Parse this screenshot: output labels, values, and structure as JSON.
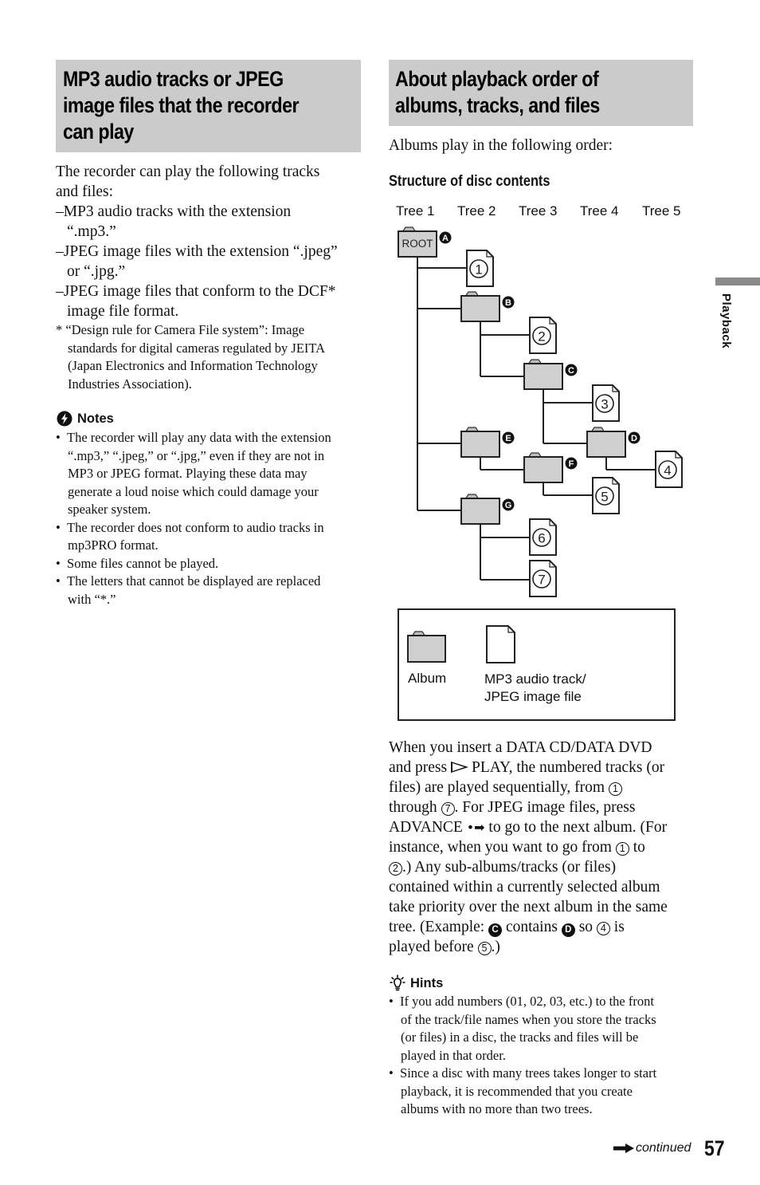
{
  "left_section": {
    "title_lines": [
      "MP3 audio tracks or JPEG",
      "image files that the recorder",
      "can play"
    ],
    "intro_lines": [
      "The recorder can play the following tracks",
      "and files:"
    ],
    "file_types": [
      {
        "dash": "–",
        "lines": [
          "MP3 audio tracks with the extension",
          "“.mp3.”"
        ]
      },
      {
        "dash": "–",
        "lines": [
          "JPEG image files with the extension “.jpeg”",
          "or “.jpg.”"
        ]
      },
      {
        "dash": "–",
        "lines": [
          "JPEG image files that conform to the DCF*",
          "image file format."
        ]
      }
    ],
    "footnote": {
      "marker": "*",
      "lines": [
        "“Design rule for Camera File system”: Image",
        "standards for digital cameras regulated by JEITA",
        "(Japan Electronics and Information Technology",
        "Industries Association)."
      ]
    },
    "notes": {
      "icon": "notes-icon",
      "heading": "Notes",
      "items": [
        {
          "bullet": "•",
          "lines": [
            "The recorder will play any data with the extension",
            "“.mp3,” “.jpeg,” or “.jpg,” even if they are not in",
            "MP3 or JPEG format. Playing these data may",
            "generate a loud noise which could damage your",
            "speaker system."
          ]
        },
        {
          "bullet": "•",
          "lines": [
            "The recorder does not conform to audio tracks in",
            "mp3PRO format."
          ]
        },
        {
          "bullet": "•",
          "lines": [
            "Some files cannot be played."
          ]
        },
        {
          "bullet": "•",
          "lines": [
            "The letters that cannot be displayed are replaced",
            "with “*.”"
          ]
        }
      ]
    }
  },
  "right_section": {
    "title_lines": [
      "About playback order of",
      "albums, tracks, and files"
    ],
    "intro": "Albums play in the following order:",
    "subheading": "Structure of disc contents",
    "diagram": {
      "tree_labels": [
        "Tree 1",
        "Tree 2",
        "Tree 3",
        "Tree 4",
        "Tree 5"
      ],
      "root_label": "ROOT",
      "albums": [
        {
          "id": "A",
          "label": "ROOT",
          "tree": 1,
          "parent": null
        },
        {
          "id": "B",
          "tree": 2,
          "parent": "A"
        },
        {
          "id": "C",
          "tree": 3,
          "parent": "B"
        },
        {
          "id": "D",
          "tree": 4,
          "parent": "C"
        },
        {
          "id": "E",
          "tree": 2,
          "parent": "A"
        },
        {
          "id": "F",
          "tree": 3,
          "parent": "E"
        },
        {
          "id": "G",
          "tree": 2,
          "parent": "A"
        }
      ],
      "files": [
        {
          "number": "1",
          "parent": "A"
        },
        {
          "number": "2",
          "parent": "B"
        },
        {
          "number": "3",
          "parent": "C"
        },
        {
          "number": "4",
          "parent": "D"
        },
        {
          "number": "5",
          "parent": "F"
        },
        {
          "number": "6",
          "parent": "G"
        },
        {
          "number": "7",
          "parent": "G"
        }
      ],
      "legend": {
        "album_label": "Album",
        "file_label_lines": [
          "MP3 audio track/",
          "JPEG image file"
        ]
      }
    },
    "explanation": {
      "l1": "When you insert a DATA CD/DATA DVD",
      "l2a": "and press ",
      "l2b": "PLAY, the numbered tracks (or",
      "l3a": "files) are played sequentially, from ",
      "c1": "1",
      "l4a": "through ",
      "c7": "7",
      "l4b": ". For JPEG image files, press",
      "l5a": "ADVANCE ",
      "adv_symbol": "•➡",
      "l5b": " to go to the next album. (For",
      "l6a": "instance, when you want to go from ",
      "l6b": " to",
      "c2": "2",
      "l7": ".) Any sub-albums/tracks (or files)",
      "l8": "contained within a currently selected album",
      "l9": "take priority over the next album in the same",
      "l10a": "tree. (Example: ",
      "bc": "C",
      "l10b": " contains ",
      "bd": "D",
      "l10c": " so ",
      "c4": "4",
      "l10d": " is",
      "l11a": "played before ",
      "c5": "5",
      "l11b": ".)"
    },
    "hints": {
      "icon": "lightbulb-icon",
      "heading": "Hints",
      "items": [
        {
          "bullet": "•",
          "lines": [
            "If you add numbers (01, 02, 03, etc.) to the front",
            "of the track/file names when you store the tracks",
            "(or files) in a disc, the tracks and files will be",
            "played in that order."
          ]
        },
        {
          "bullet": "•",
          "lines": [
            "Since a disc with many trees takes longer to start",
            "playback, it is recommended that you create",
            "albums with no more than two trees."
          ]
        }
      ]
    }
  },
  "side_tab": {
    "label": "Playback"
  },
  "footer": {
    "continued": "continued",
    "page_number": "57"
  }
}
